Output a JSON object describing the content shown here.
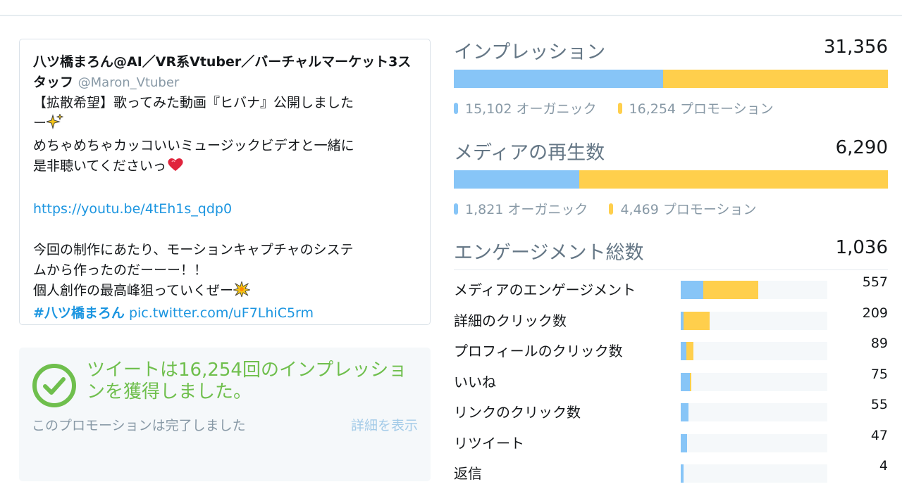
{
  "tweet": {
    "author_name": "八ツ橋まろん@AI／VR系Vtuber／バーチャルマーケット3スタッフ",
    "handle": "@Maron_Vtuber",
    "line1": "【拡散希望】歌ってみた動画『ヒバナ』公開しました",
    "line2": "ー",
    "line3": "めちゃめちゃカッコいいミュージックビデオと一緒に",
    "line4": "是非聴いてくださいっ",
    "link": "https://youtu.be/4tEh1s_qdp0",
    "line5": "今回の制作にあたり、モーションキャプチャのシステ",
    "line6": "ムから作ったのだーーー！！",
    "line7": "個人創作の最高峰狙っていくぜー",
    "hashtag": "#八ツ橋まろん",
    "pic_link": "pic.twitter.com/uF7LhiC5rm"
  },
  "promotion": {
    "title": "ツイートは16,254回のインプレッションを獲得しました。",
    "status": "このプロモーションは完了しました",
    "details_link": "詳細を表示"
  },
  "impressions": {
    "label": "インプレッション",
    "total": "31,356",
    "organic": "15,102 オーガニック",
    "promoted": "16,254 プロモーション",
    "organic_value": 15102,
    "promoted_value": 16254
  },
  "media_views": {
    "label": "メディアの再生数",
    "total": "6,290",
    "organic": "1,821 オーガニック",
    "promoted": "4,469 プロモーション",
    "organic_value": 1821,
    "promoted_value": 4469
  },
  "engagements": {
    "label": "エンゲージメント総数",
    "total": "1,036",
    "scale_max": 557,
    "rows": [
      {
        "label": "メディアのエンゲージメント",
        "count": "557",
        "organic": 161,
        "promoted": 396
      },
      {
        "label": "詳細のクリック数",
        "count": "209",
        "organic": 22,
        "promoted": 187
      },
      {
        "label": "プロフィールのクリック数",
        "count": "89",
        "organic": 38,
        "promoted": 51
      },
      {
        "label": "いいね",
        "count": "75",
        "organic": 67,
        "promoted": 8
      },
      {
        "label": "リンクのクリック数",
        "count": "55",
        "organic": 55,
        "promoted": 0
      },
      {
        "label": "リツイート",
        "count": "47",
        "organic": 47,
        "promoted": 0
      },
      {
        "label": "返信",
        "count": "4",
        "organic": 4,
        "promoted": 0
      }
    ]
  },
  "colors": {
    "organic": "#87c5f7",
    "promoted": "#ffcf4c",
    "success": "#6fbf4d",
    "link": "#1b95e0"
  }
}
